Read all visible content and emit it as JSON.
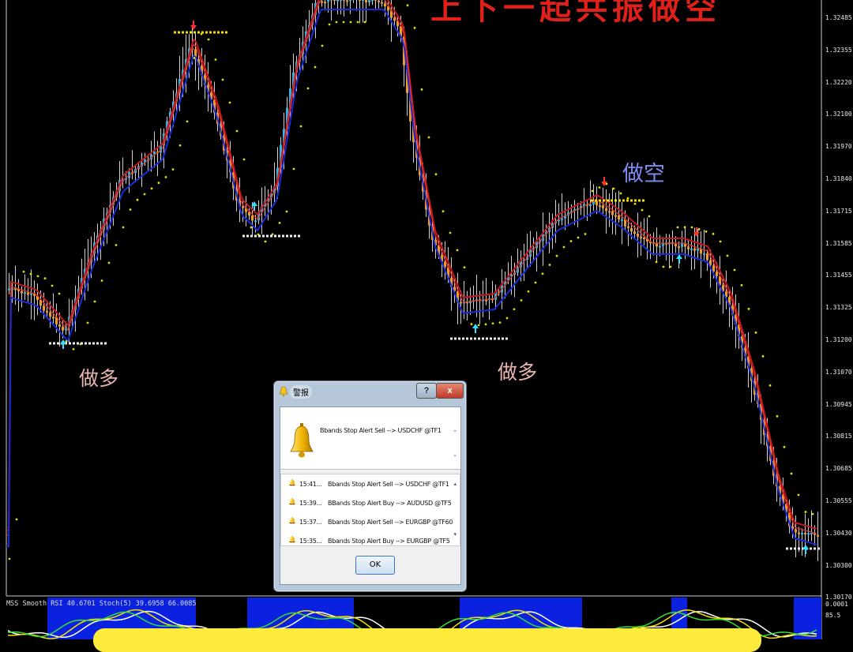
{
  "title_text": "上下一起共振做空",
  "signal_labels": {
    "long_1": "做多",
    "long_2": "做多",
    "short_1": "做空"
  },
  "price_axis": [
    "1.32485",
    "1.32355",
    "1.32220",
    "1.32100",
    "1.31970",
    "1.31840",
    "1.31715",
    "1.31585",
    "1.31455",
    "1.31325",
    "1.31200",
    "1.31070",
    "1.30945",
    "1.30815",
    "1.30685",
    "1.30555",
    "1.30430",
    "1.30300",
    "1.30170",
    "0.0001",
    "85.5"
  ],
  "indicator_label": "MSS  Smooth RSI 40.6701  Stoch(5) 39.6958 66.0085",
  "colors": {
    "background": "#000000",
    "bull_candle": "#29b6e8",
    "bear_candle": "#f39c23",
    "upper_line": "#c0181e",
    "lower_line": "#1a2bd6",
    "dots": "#e6e000",
    "indicator_bg": "#0a22e0"
  },
  "dialog": {
    "title": "警报",
    "help_label": "?",
    "close_label": "x",
    "message": "Bbands Stop Alert Sell --> USDCHF @TF1",
    "history": [
      {
        "time": "15:41...",
        "text": "Bbands Stop Alert Sell --> USDCHF @TF1"
      },
      {
        "time": "15:39...",
        "text": "BBands Stop Alert Buy --> AUDUSD @TF5"
      },
      {
        "time": "15:37...",
        "text": "Bbands Stop Alert Sell --> EURGBP @TF60"
      },
      {
        "time": "15:35...",
        "text": "Bbands Stop Alert Buy --> EURGBP @TF5"
      }
    ],
    "ok_label": "OK"
  },
  "chart_data": {
    "type": "candlestick",
    "instrument_hint": "forex",
    "approx_close_path": [
      1.3142,
      1.314,
      1.3132,
      1.3128,
      1.315,
      1.318,
      1.32,
      1.3205,
      1.321,
      1.3225,
      1.324,
      1.323,
      1.32,
      1.318,
      1.3175,
      1.319,
      1.322,
      1.324,
      1.325,
      1.3248,
      1.321,
      1.316,
      1.3135,
      1.3125,
      1.313,
      1.314,
      1.315,
      1.316,
      1.3168,
      1.3172,
      1.3165,
      1.3158,
      1.3155,
      1.316,
      1.315,
      1.313,
      1.311,
      1.309,
      1.307,
      1.305,
      1.304,
      1.3035
    ],
    "grid": false
  }
}
